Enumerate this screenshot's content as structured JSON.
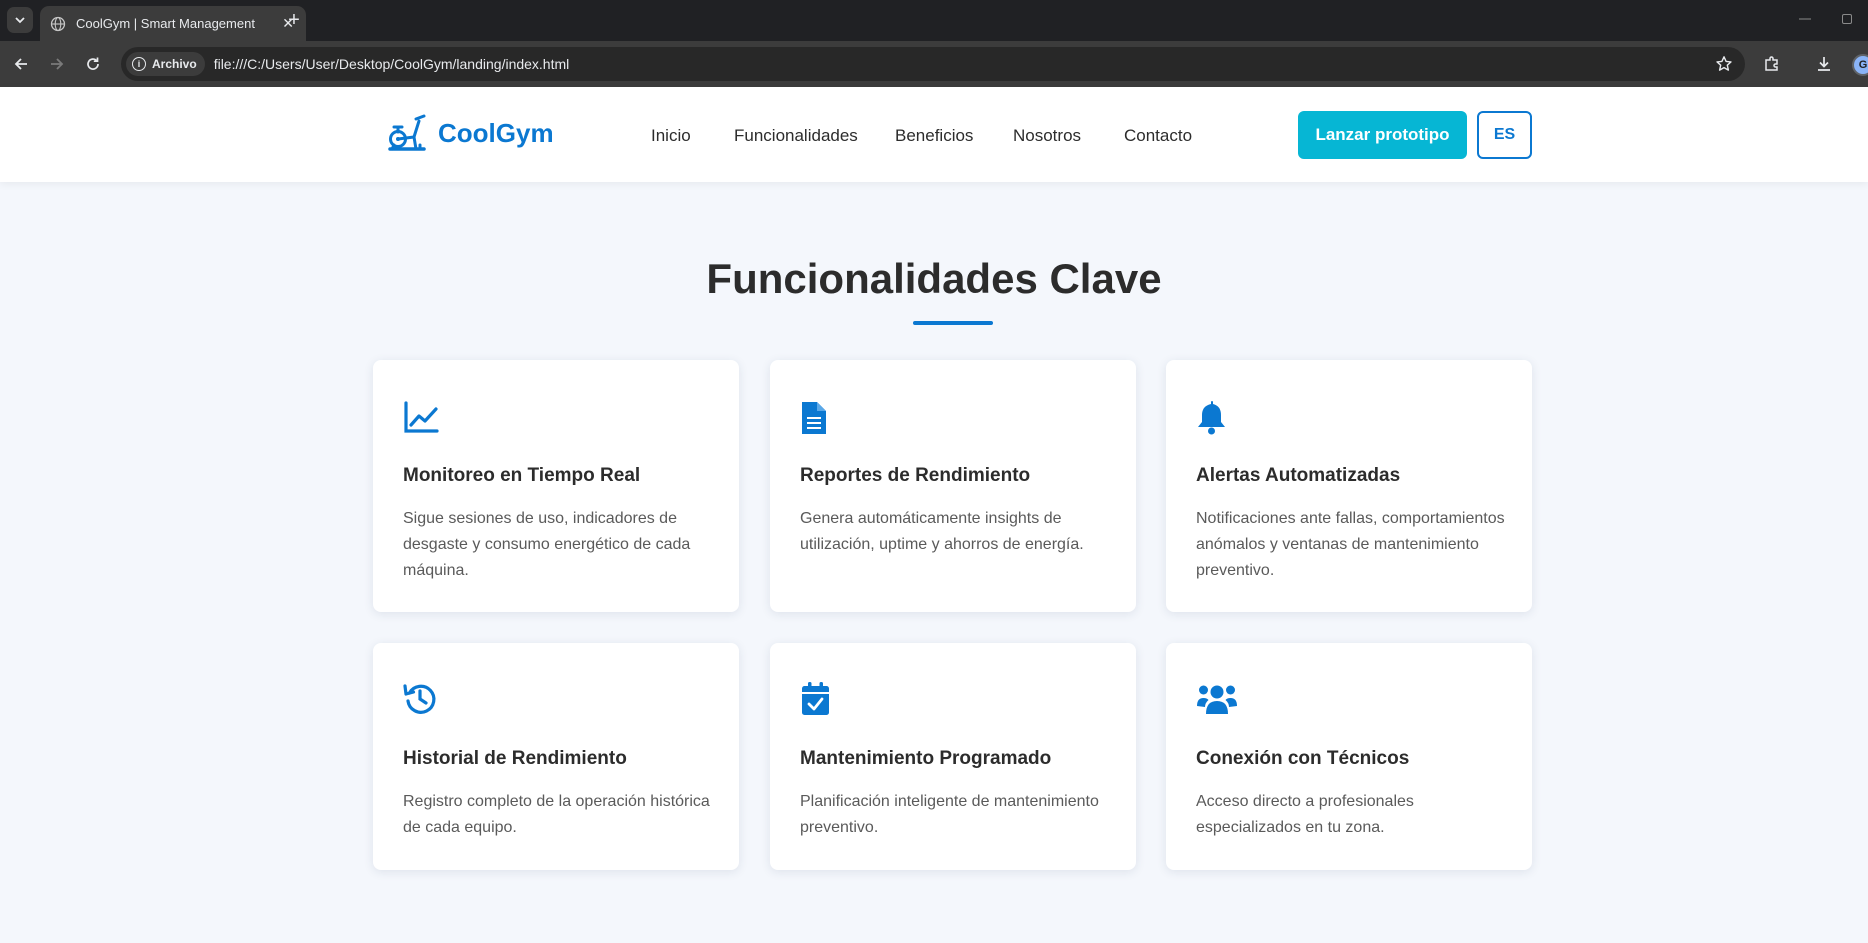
{
  "browser": {
    "tab_title": "CoolGym | Smart Management",
    "address_chip": "Archivo",
    "url": "file:///C:/Users/User/Desktop/CoolGym/landing/index.html",
    "profile_initial": "G"
  },
  "header": {
    "brand": "CoolGym",
    "nav": [
      "Inicio",
      "Funcionalidades",
      "Beneficios",
      "Nosotros",
      "Contacto"
    ],
    "cta_label": "Lanzar prototipo",
    "language": "ES"
  },
  "section": {
    "title": "Funcionalidades Clave",
    "cards": [
      {
        "icon": "chart-line-icon",
        "title": "Monitoreo en Tiempo Real",
        "desc": "Sigue sesiones de uso, indicadores de desgaste y consumo energético de cada máquina."
      },
      {
        "icon": "file-text-icon",
        "title": "Reportes de Rendimiento",
        "desc": "Genera automáticamente insights de utilización, uptime y ahorros de energía."
      },
      {
        "icon": "bell-icon",
        "title": "Alertas Automatizadas",
        "desc": "Notificaciones ante fallas, comportamientos anómalos y ventanas de mantenimiento preventivo."
      },
      {
        "icon": "history-icon",
        "title": "Historial de Rendimiento",
        "desc": "Registro completo de la operación histórica de cada equipo."
      },
      {
        "icon": "calendar-check-icon",
        "title": "Mantenimiento Programado",
        "desc": "Planificación inteligente de mantenimiento preventivo."
      },
      {
        "icon": "users-icon",
        "title": "Conexión con Técnicos",
        "desc": "Acceso directo a profesionales especializados en tu zona."
      }
    ]
  },
  "colors": {
    "brand": "#0b78d1",
    "cta": "#06b6d4",
    "background": "#f4f7fc",
    "text": "#2c2c2c"
  }
}
